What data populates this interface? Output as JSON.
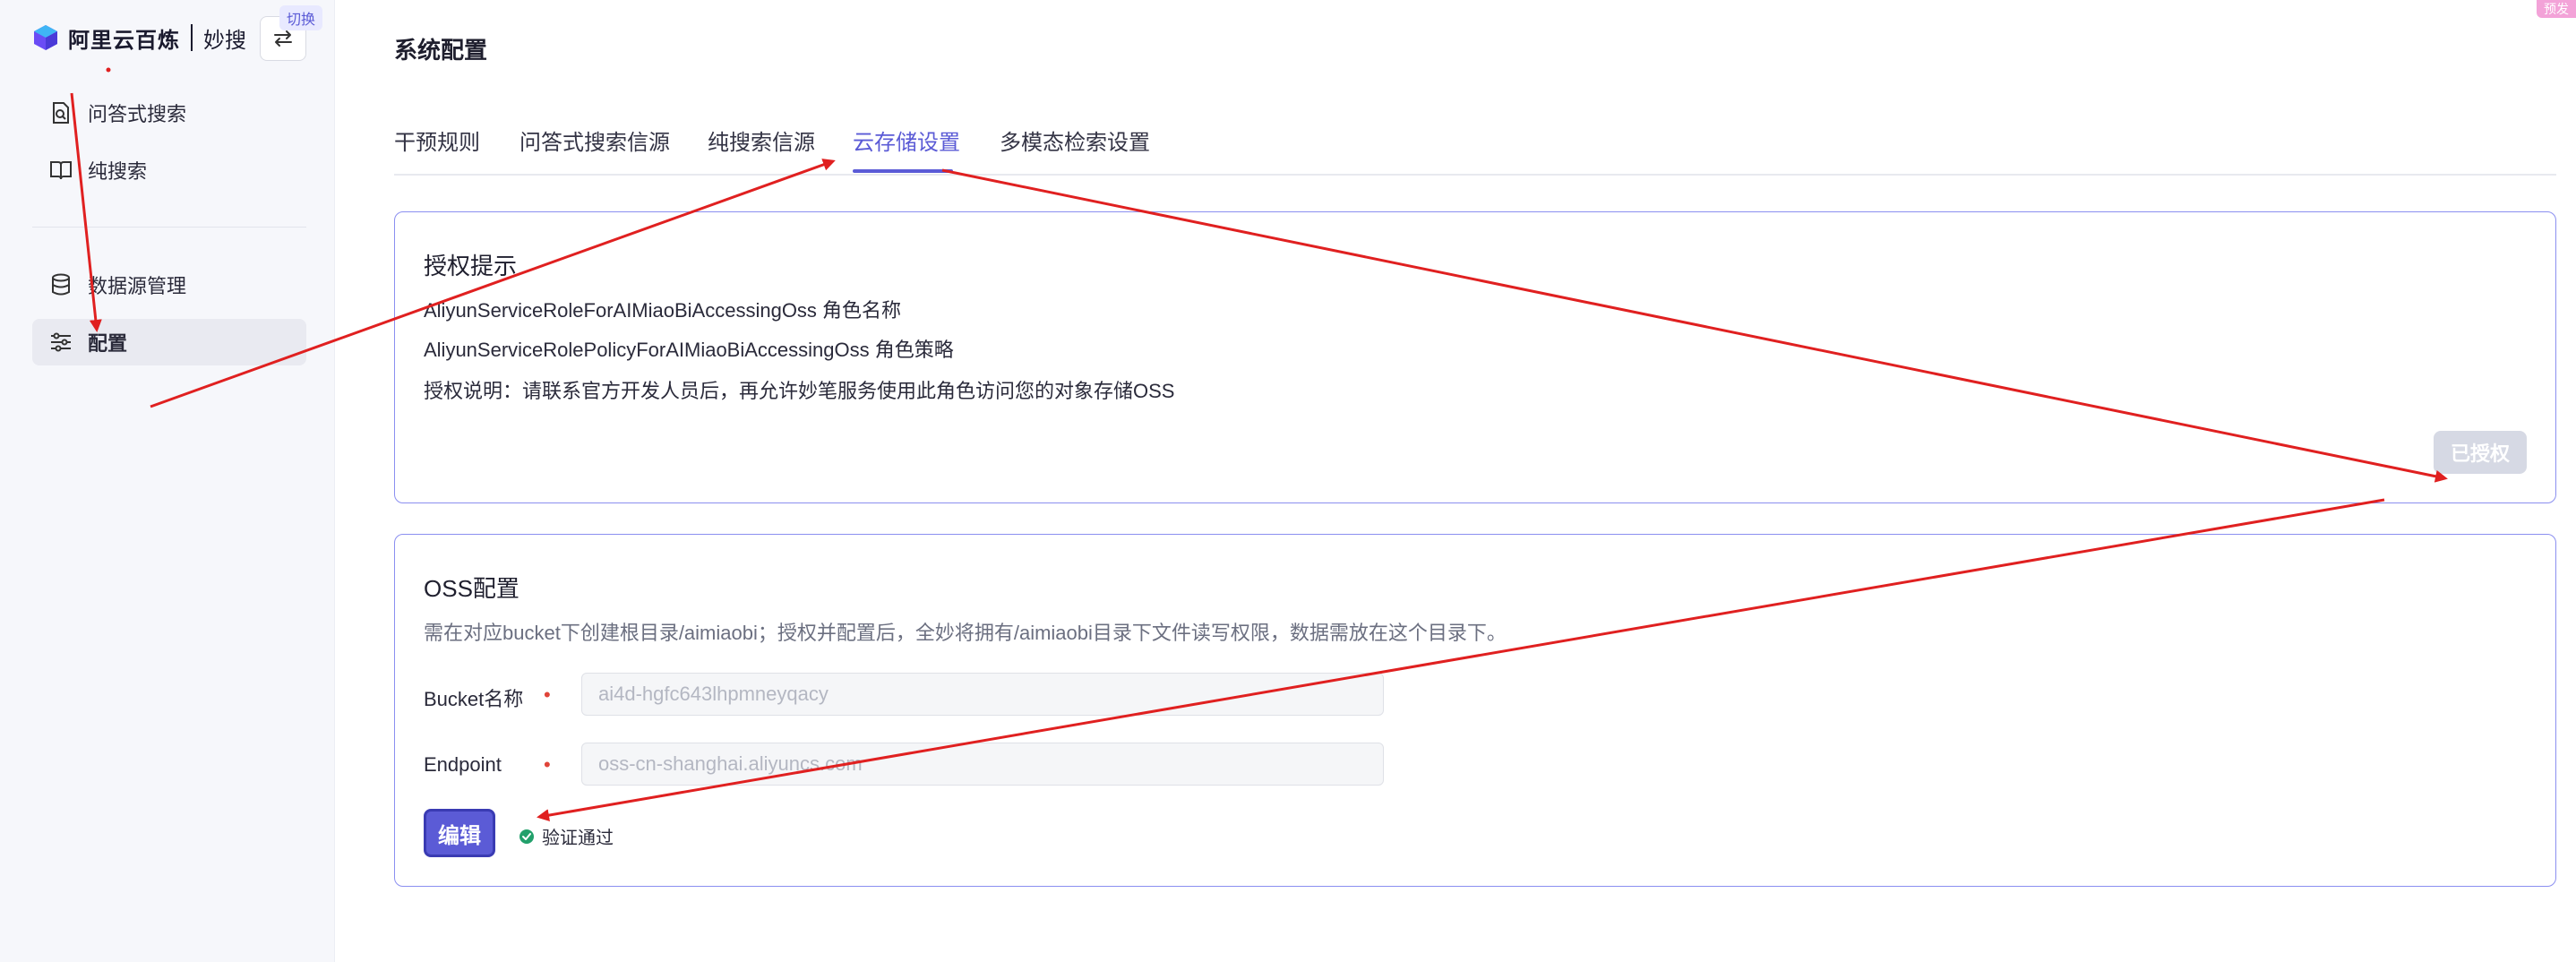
{
  "brand": {
    "name": "阿里云百炼",
    "product": "妙搜",
    "switch_tag": "切换"
  },
  "sidebar": {
    "items": [
      {
        "label": "问答式搜索",
        "icon": "file-search-icon"
      },
      {
        "label": "纯搜索",
        "icon": "book-open-icon"
      },
      {
        "label": "数据源管理",
        "icon": "database-icon"
      },
      {
        "label": "配置",
        "icon": "sliders-icon",
        "active": true
      }
    ]
  },
  "page": {
    "title": "系统配置"
  },
  "tabs": [
    {
      "label": "干预规则"
    },
    {
      "label": "问答式搜索信源"
    },
    {
      "label": "纯搜索信源"
    },
    {
      "label": "云存储设置",
      "active": true
    },
    {
      "label": "多模态检索设置"
    }
  ],
  "auth_card": {
    "title": "授权提示",
    "role_name_line": "AliyunServiceRoleForAIMiaoBiAccessingOss 角色名称",
    "role_policy_line": "AliyunServiceRolePolicyForAIMiaoBiAccessingOss 角色策略",
    "description": "授权说明：请联系官方开发人员后，再允许妙笔服务使用此角色访问您的对象存储OSS",
    "button_label": "已授权"
  },
  "oss_card": {
    "title": "OSS配置",
    "hint": "需在对应bucket下创建根目录/aimiaobi；授权并配置后，全妙将拥有/aimiaobi目录下文件读写权限，数据需放在这个目录下。",
    "bucket": {
      "label": "Bucket名称",
      "value": "ai4d-hgfc643lhpmneyqacy"
    },
    "endpoint": {
      "label": "Endpoint",
      "value": "oss-cn-shanghai.aliyuncs.com"
    },
    "required_mark": "•",
    "edit_label": "编辑",
    "status_text": "验证通过"
  },
  "corner_badge": "预发",
  "colors": {
    "accent": "#5b5bd6",
    "annotation": "#e02020",
    "success": "#22a06b"
  }
}
